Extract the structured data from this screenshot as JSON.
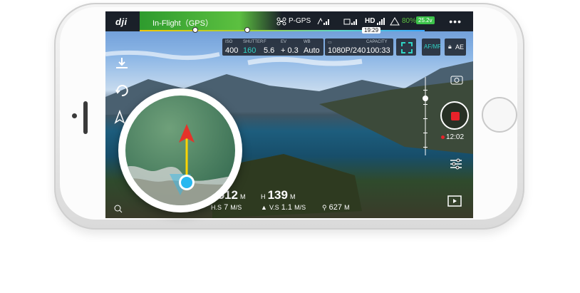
{
  "app": {
    "brand": "dji"
  },
  "topbar": {
    "flight_status": "In-Flight（GPS）",
    "mode": "P-GPS",
    "hd_label": "HD",
    "battery_percent": "80%",
    "voltage": "25.2v",
    "menu_icon": "more-dots-icon",
    "time_tag": "19:29"
  },
  "camera_params": {
    "iso": {
      "label": "ISO",
      "value": "400"
    },
    "shutter": {
      "label": "SHUTTER",
      "value": "160"
    },
    "aperture": {
      "label": "F",
      "value": "5.6"
    },
    "ev": {
      "label": "EV",
      "value": "+ 0.3"
    },
    "wb": {
      "label": "WB",
      "value": "Auto"
    },
    "format": {
      "label": "",
      "value": "1080P/240"
    },
    "capacity": {
      "label": "CAPACITY",
      "value": "100:33"
    },
    "focus_mode": "AF/MF",
    "exposure_lock": "AE"
  },
  "record": {
    "time": "12:02"
  },
  "telemetry": {
    "distance_label": "D",
    "distance_value": "512",
    "distance_unit": "M",
    "height_label": "H",
    "height_value": "139",
    "height_unit": "M",
    "hspeed_label": "H.S",
    "hspeed_value": "7",
    "hspeed_unit": "M/S",
    "vspeed_label": "V.S",
    "vspeed_value": "1.1",
    "vspeed_unit": "M/S",
    "home_distance_value": "627",
    "home_distance_unit": "M"
  },
  "colors": {
    "status_green": "#5cc040",
    "record_red": "#e8222a",
    "accent_cyan": "#2fd3c4",
    "battery_green": "#3cc24a",
    "aircraft_arrow": "#e5332a",
    "heading_line": "#ffd400",
    "home_point": "#28b8f0"
  },
  "icons": [
    "takeoff-icon",
    "return-home-icon",
    "navigation-icon",
    "settings-sliders-icon",
    "playback-icon",
    "camera-switch-icon",
    "zoom-icon",
    "drone-icon",
    "signal-icon",
    "remote-icon",
    "wifi-icon",
    "battery-icon",
    "lock-icon"
  ]
}
